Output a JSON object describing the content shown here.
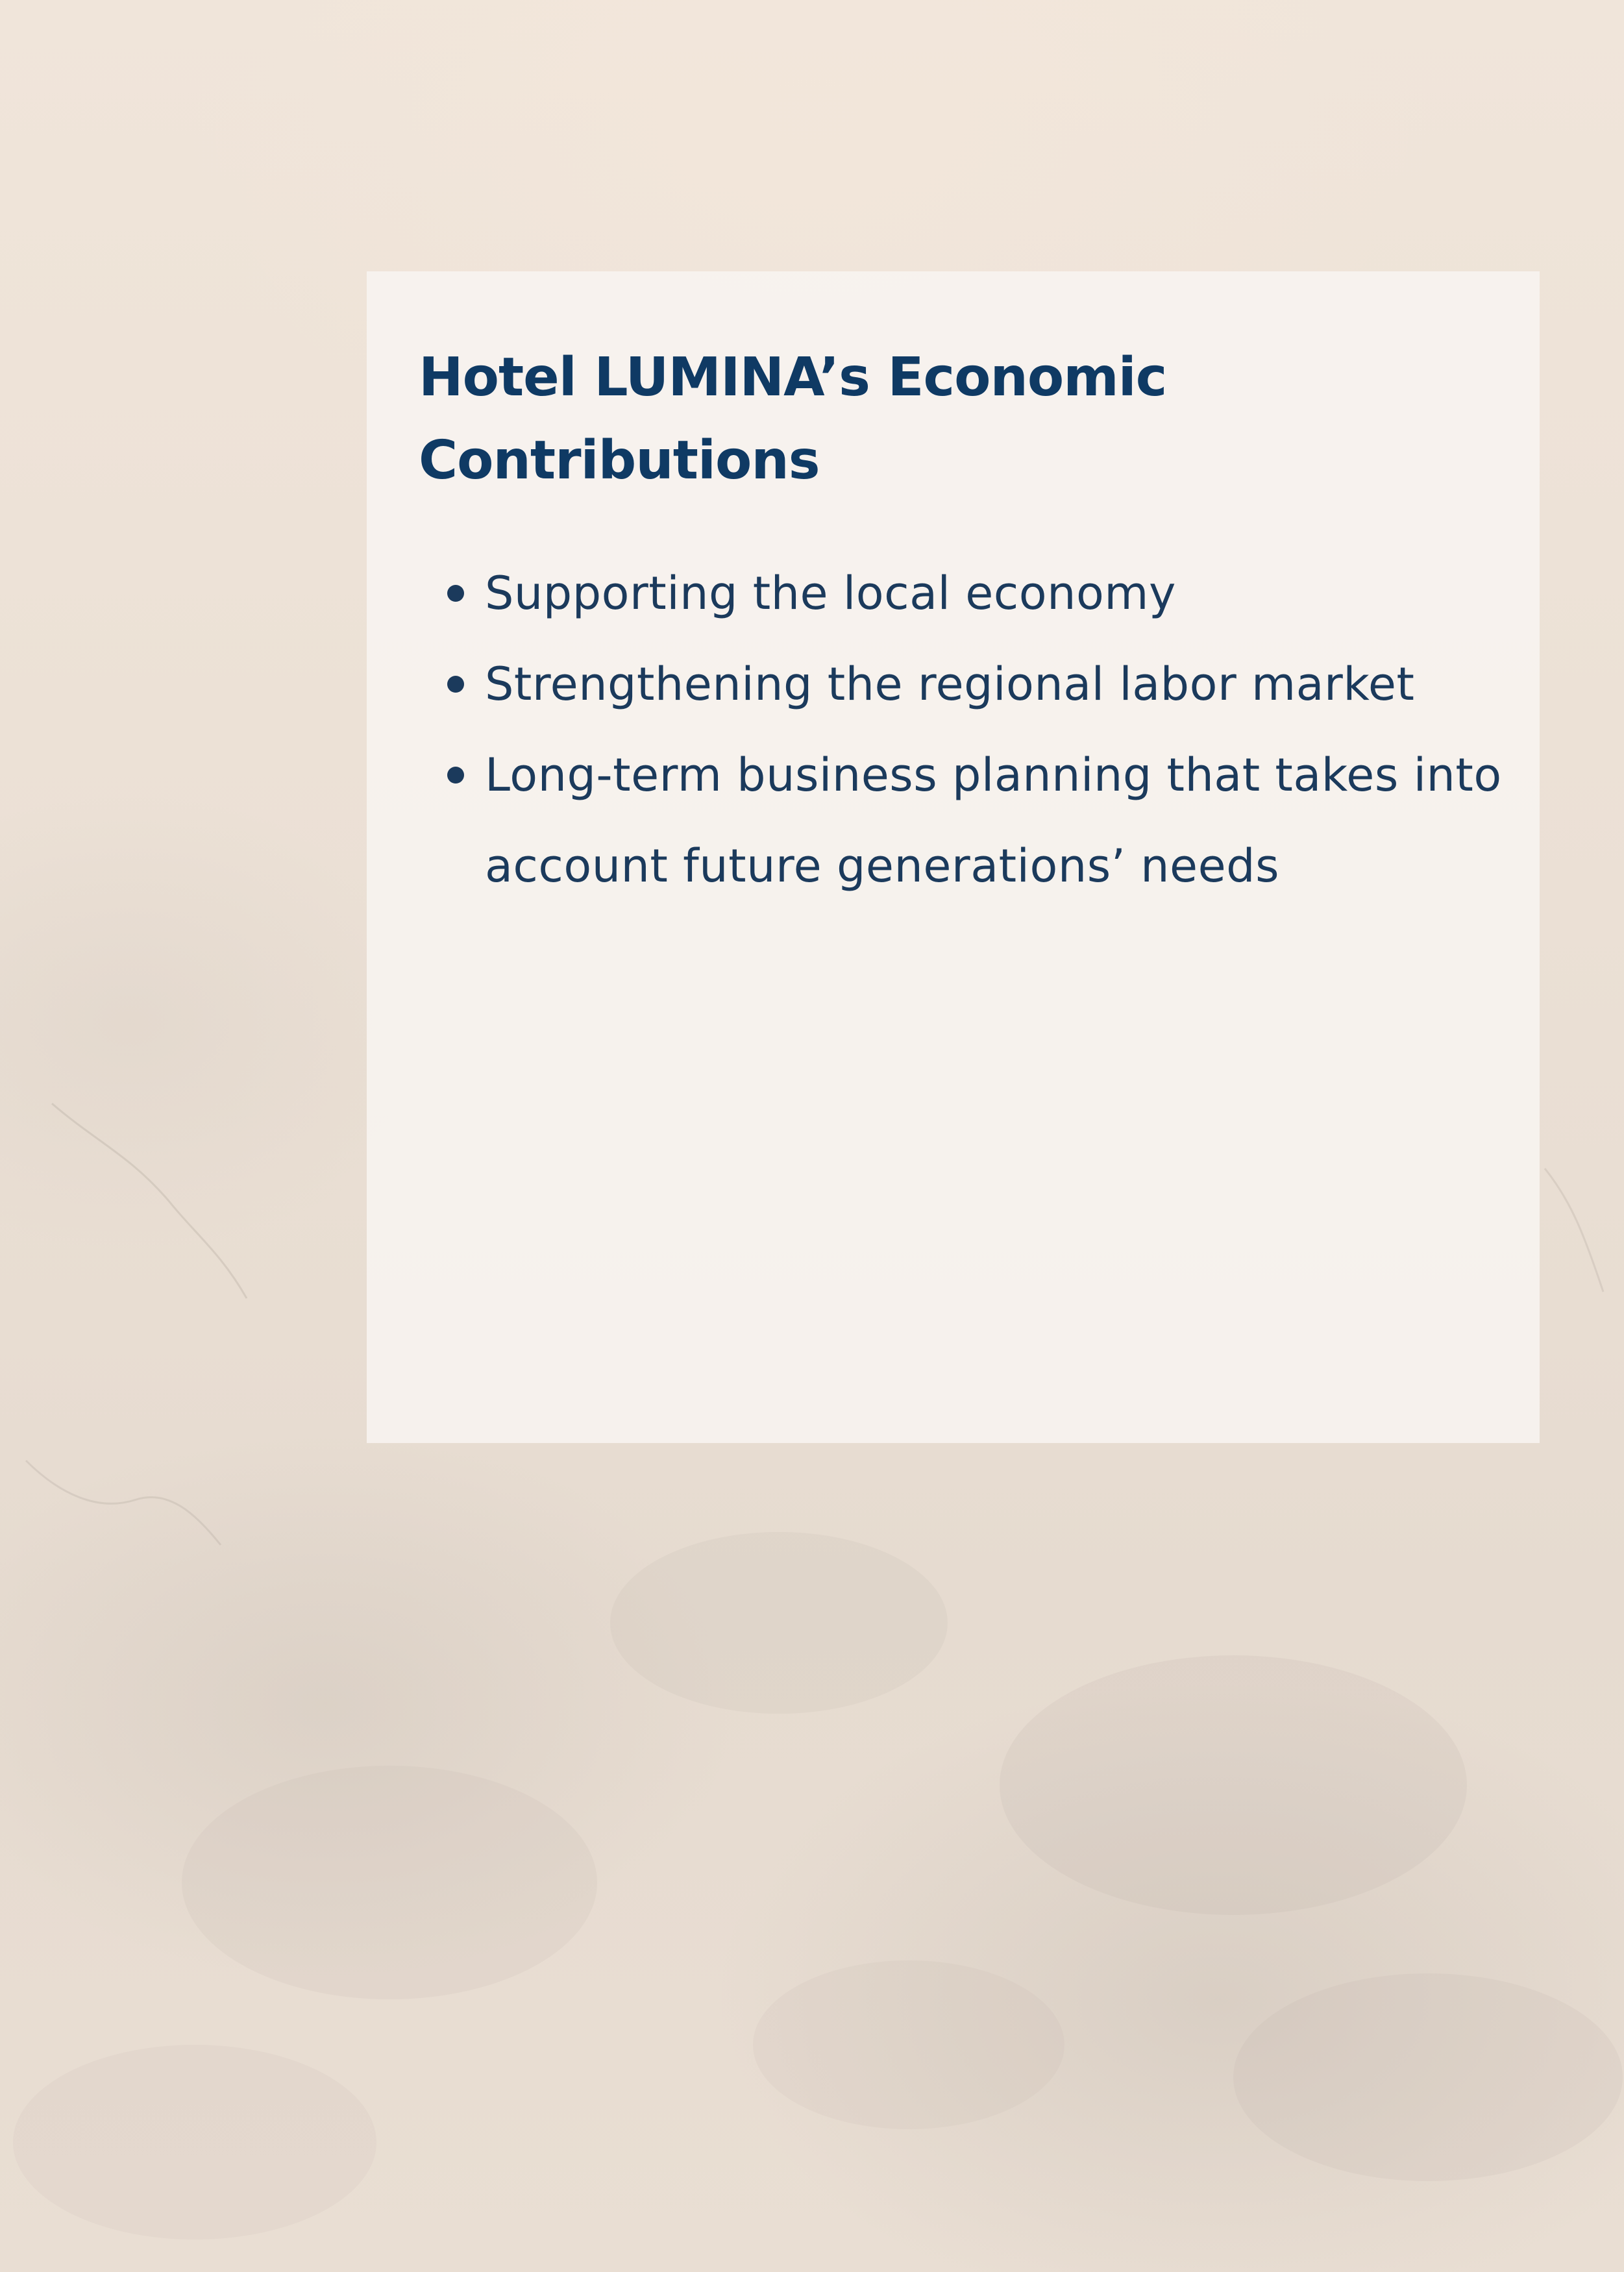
{
  "page": {
    "background_color": "#ece2d8",
    "panel_color": "#f8f5f1",
    "title_color": "#0f3a64",
    "text_color": "#1b3a5c"
  },
  "content": {
    "title": "Hotel LUMINA’s Economic Contributions",
    "bullets": [
      "Supporting the local economy",
      "Strengthening the regional labor market",
      "Long-term business planning that takes into account future generations’ needs"
    ]
  }
}
